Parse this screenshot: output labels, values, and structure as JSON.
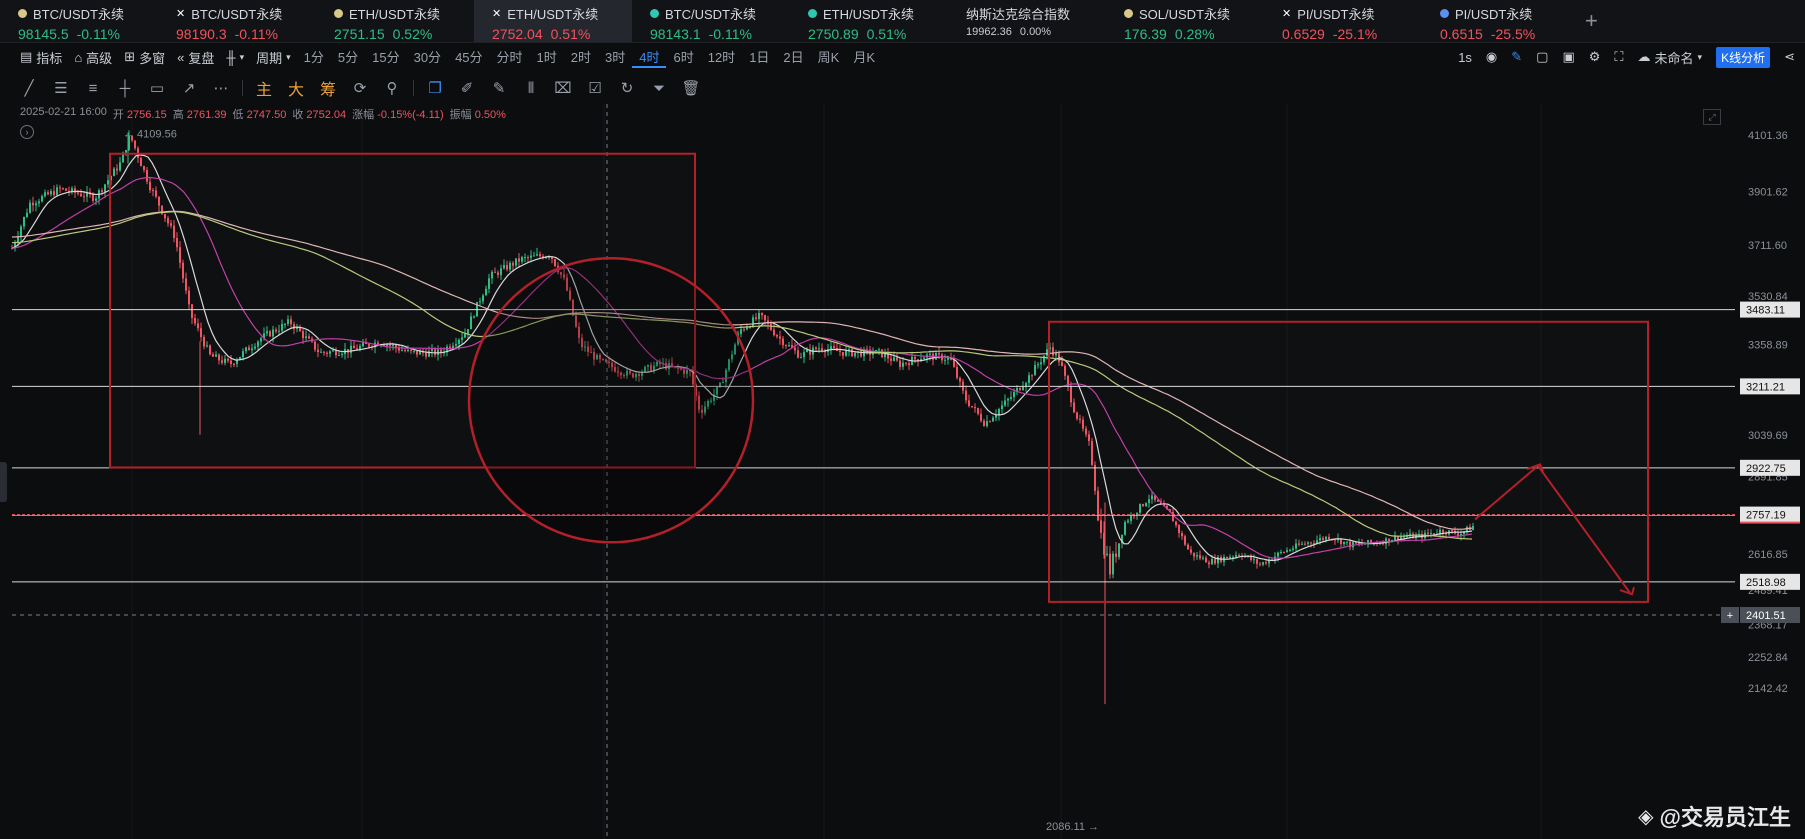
{
  "tickers": [
    {
      "name": "BTC/USDT永续",
      "price": "98145.5",
      "change": "-0.11%",
      "dir": "up",
      "icon": "btc-coin-icon",
      "iconColor": "#d8c98a"
    },
    {
      "name": "BTC/USDT永续",
      "price": "98190.3",
      "change": "-0.11%",
      "dir": "dn",
      "icon": "okx-x-icon",
      "iconColor": "#ffffff"
    },
    {
      "name": "ETH/USDT永续",
      "price": "2751.15",
      "change": "0.52%",
      "dir": "up",
      "icon": "eth-coin-icon",
      "iconColor": "#d8c98a"
    },
    {
      "name": "ETH/USDT永续",
      "price": "2752.04",
      "change": "0.51%",
      "dir": "dn",
      "icon": "okx-logo-icon",
      "iconColor": "#ffffff"
    },
    {
      "name": "BTC/USDT永续",
      "price": "98143.1",
      "change": "-0.11%",
      "dir": "up",
      "icon": "teal-coin-icon",
      "iconColor": "#2ec7b0"
    },
    {
      "name": "ETH/USDT永续",
      "price": "2750.89",
      "change": "0.51%",
      "dir": "up",
      "icon": "teal-coin-icon",
      "iconColor": "#2ec7b0"
    },
    {
      "name": "纳斯达克综合指数",
      "price": "19962.36",
      "change": "0.00%",
      "dir": "plain",
      "icon": "",
      "iconColor": ""
    },
    {
      "name": "SOL/USDT永续",
      "price": "176.39",
      "change": "0.28%",
      "dir": "up",
      "icon": "sol-coin-icon",
      "iconColor": "#d8c98a"
    },
    {
      "name": "PI/USDT永续",
      "price": "0.6529",
      "change": "-25.1%",
      "dir": "dn",
      "icon": "okx-x-icon",
      "iconColor": "#ffffff"
    },
    {
      "name": "PI/USDT永续",
      "price": "0.6515",
      "change": "-25.5%",
      "dir": "dn",
      "icon": "blue-coin-icon",
      "iconColor": "#5b8ff0"
    }
  ],
  "toolbar": {
    "indicators": "指标",
    "advanced": "高级",
    "multi": "多窗",
    "replay": "复盘",
    "period": "周期",
    "periods": [
      "1分",
      "5分",
      "15分",
      "30分",
      "45分",
      "分时",
      "1时",
      "2时",
      "3时",
      "4时",
      "6时",
      "12时",
      "1日",
      "2日",
      "周K",
      "月K"
    ],
    "active_period": "4时",
    "interval": "1s",
    "layout_name": "未命名",
    "kline_btn": "K线分析"
  },
  "drawing_tools": {
    "main": "主",
    "big": "大",
    "chip": "筹"
  },
  "ohlc": {
    "date": "2025-02-21 16:00",
    "open_label": "开",
    "open": "2756.15",
    "high_label": "高",
    "high": "2761.39",
    "low_label": "低",
    "low": "2747.50",
    "close_label": "收",
    "close": "2752.04",
    "chg_label": "涨幅",
    "chg": "-0.15%(-4.11)",
    "amp_label": "振幅",
    "amp": "0.50%"
  },
  "chart": {
    "y_range": [
      2100,
      4200
    ],
    "axis_ticks": [
      "4101.36",
      "3901.62",
      "3711.60",
      "3530.84",
      "3358.89",
      "3039.69",
      "2891.85",
      "2616.85",
      "2489.41",
      "2368.17",
      "2252.84",
      "2142.42"
    ],
    "axis_tick_values": [
      4101.36,
      3901.62,
      3711.6,
      3530.84,
      3358.89,
      3039.69,
      2891.85,
      2616.85,
      2489.41,
      2368.17,
      2252.84,
      2142.42
    ],
    "levels": [
      {
        "label": "3483.11",
        "value": 3483.11
      },
      {
        "label": "3211.21",
        "value": 3211.21
      },
      {
        "label": "2922.75",
        "value": 2922.75
      },
      {
        "label": "2518.98",
        "value": 2518.98
      }
    ],
    "current_price": {
      "label": "2757.19",
      "value": 2757.19
    },
    "crosshair": {
      "label": "2401.51",
      "value": 2401.51
    },
    "high_marker": "← 4109.56",
    "low_marker": "2086.11 →"
  },
  "watermark": "@交易员江生"
}
